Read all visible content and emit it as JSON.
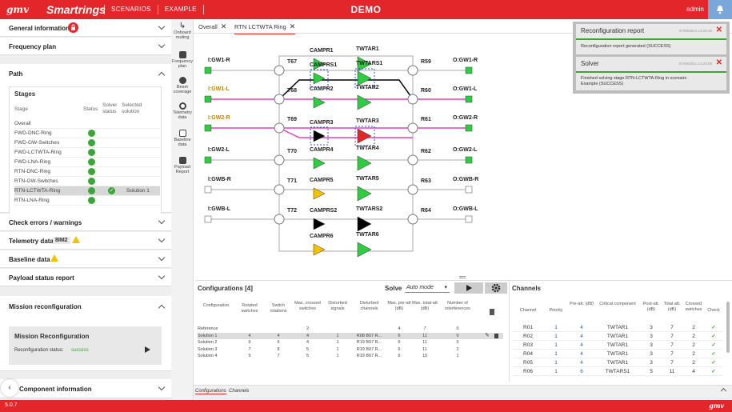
{
  "app": {
    "logo": "gmv",
    "name": "Smartrings",
    "breadcrumbs": [
      "SCENARIOS",
      "EXAMPLE"
    ],
    "demo": "DEMO",
    "user": "admin",
    "version": "5.0.7",
    "footer_logo": "gmv"
  },
  "colors": {
    "brand": "#e2262a",
    "ok": "#3aa635",
    "warn": "#f2c200",
    "magenta": "#e040c0"
  },
  "left": {
    "general": "General information",
    "frequency": "Frequency plan",
    "path": "Path",
    "stages": {
      "title": "Stages",
      "headers": {
        "stage": "Stage",
        "status": "Status",
        "solver": "Solver status",
        "selected": "Selected solution"
      },
      "rows": [
        {
          "name": "Overall",
          "status": false,
          "solver": false,
          "sol": ""
        },
        {
          "name": "FWD-DNC-Ring",
          "status": true,
          "solver": false,
          "sol": ""
        },
        {
          "name": "FWD-GW-Switches",
          "status": true,
          "solver": false,
          "sol": ""
        },
        {
          "name": "FWD-LCTWTA-Ring",
          "status": true,
          "solver": false,
          "sol": ""
        },
        {
          "name": "FWD-LNA-Ring",
          "status": true,
          "solver": false,
          "sol": ""
        },
        {
          "name": "RTN-DNC-Ring",
          "status": true,
          "solver": false,
          "sol": ""
        },
        {
          "name": "RTN-GW-Switches",
          "status": true,
          "solver": false,
          "sol": ""
        },
        {
          "name": "RTN-LCTWTA-Ring",
          "status": true,
          "solver": true,
          "sol": "Solution 1"
        },
        {
          "name": "RTN-LNA-Ring",
          "status": true,
          "solver": false,
          "sol": ""
        }
      ]
    },
    "check": "Check errors / warnings",
    "telemetry": "Telemetry data",
    "telemetry_badge": "8IM2",
    "baseline": "Baseline data",
    "payload": "Payload status report",
    "mission": "Mission reconfiguration",
    "mission_box_title": "Mission Reconfiguration",
    "reconf_label": "Reconfiguration status:",
    "reconf_status": "success",
    "component": "Component information"
  },
  "iconbar": [
    {
      "label": "Onboard routing"
    },
    {
      "label": "Frequency plan"
    },
    {
      "label": "Beam coverage"
    },
    {
      "label": "Telemetry data"
    },
    {
      "label": "Baseline data"
    },
    {
      "label": "Payload Report"
    }
  ],
  "tabs": [
    {
      "label": "Overall"
    },
    {
      "label": "RTN LCTWTA Ring"
    }
  ],
  "notifications": [
    {
      "title": "Reconfiguration report",
      "time": "07/09/2021 13:22:29",
      "text": "Reconfiguration report generated (SUCCESS)"
    },
    {
      "title": "Solver",
      "time": "07/09/2021 13:22:08",
      "text1": "Finished solving stage RTN-LCTWTA-Ring in scenario",
      "text2": "Example (SUCCESS)"
    }
  ],
  "diagram": {
    "in_ports": [
      "I:GW1-R",
      "I:GW1-L",
      "I:GW2-R",
      "I:GW2-L",
      "I:GWB-R",
      "I:GWB-L"
    ],
    "out_ports": [
      "O:GW1-R",
      "O:GW1-L",
      "O:GW2-R",
      "O:GW2-L",
      "O:GWB-R",
      "O:GWB-L"
    ],
    "t_switches": [
      "T67",
      "T68",
      "T69",
      "T70",
      "T71",
      "T72"
    ],
    "r_switches": [
      "R59",
      "R60",
      "R61",
      "R62",
      "R63",
      "R64"
    ],
    "campr": [
      "CAMPR1",
      "CAMPRS1",
      "CAMPR2",
      "CAMPR3",
      "CAMPR4",
      "CAMPR5",
      "CAMPRS2",
      "CAMPR6"
    ],
    "twtar": [
      "TWTAR1",
      "TWTARS1",
      "TWTAR2",
      "TWTAR3",
      "TWTAR4",
      "TWTAR5",
      "TWTARS2",
      "TWTAR6"
    ]
  },
  "configs": {
    "title": "Configurations [4]",
    "solve": "Solve",
    "mode": "Auto mode",
    "headers": [
      "Configuration",
      "Rotated switches",
      "Switch rotations",
      "Max. crossed switches",
      "Disturbed signals",
      "Disturbed channels",
      "Max. pre-att (dB)",
      "Max. total-att (dB)",
      "Number of interferences"
    ],
    "rows": [
      [
        "Reference",
        "",
        "",
        "2",
        "",
        "",
        "4",
        "7",
        "0"
      ],
      [
        "Solution 1",
        "4",
        "4",
        "4",
        "1",
        "R08 B07 R...",
        "6",
        "11",
        "0"
      ],
      [
        "Solution 2",
        "6",
        "6",
        "4",
        "1",
        "R19 B07 R...",
        "6",
        "11",
        "0"
      ],
      [
        "Solution 3",
        "7",
        "8",
        "5",
        "1",
        "R19 B07 R...",
        "6",
        "11",
        "2"
      ],
      [
        "Solution 4",
        "5",
        "7",
        "5",
        "1",
        "R19 B07 R...",
        "6",
        "15",
        "1"
      ]
    ]
  },
  "channels": {
    "title": "Channels",
    "headers": [
      "Channel",
      "Priority",
      "Pre-att. (dB)",
      "Critical component",
      "Post-att. (dB)",
      "Total att. (dB)",
      "Crossed switches",
      "Check"
    ],
    "rows": [
      [
        "R01",
        "1",
        "4",
        "TWTAR1",
        "3",
        "7",
        "2",
        "✓"
      ],
      [
        "R02",
        "1",
        "4",
        "TWTAR1",
        "3",
        "7",
        "2",
        "✓"
      ],
      [
        "R03",
        "1",
        "4",
        "TWTAR1",
        "3",
        "7",
        "2",
        "✓"
      ],
      [
        "R04",
        "1",
        "4",
        "TWTAR1",
        "3",
        "7",
        "2",
        "✓"
      ],
      [
        "R05",
        "1",
        "4",
        "TWTAR1",
        "3",
        "7",
        "2",
        "✓"
      ],
      [
        "R06",
        "1",
        "6",
        "TWTARS1",
        "5",
        "11",
        "4",
        "✓"
      ]
    ]
  },
  "bottom_tabs": [
    "Configurations",
    "Channels"
  ]
}
